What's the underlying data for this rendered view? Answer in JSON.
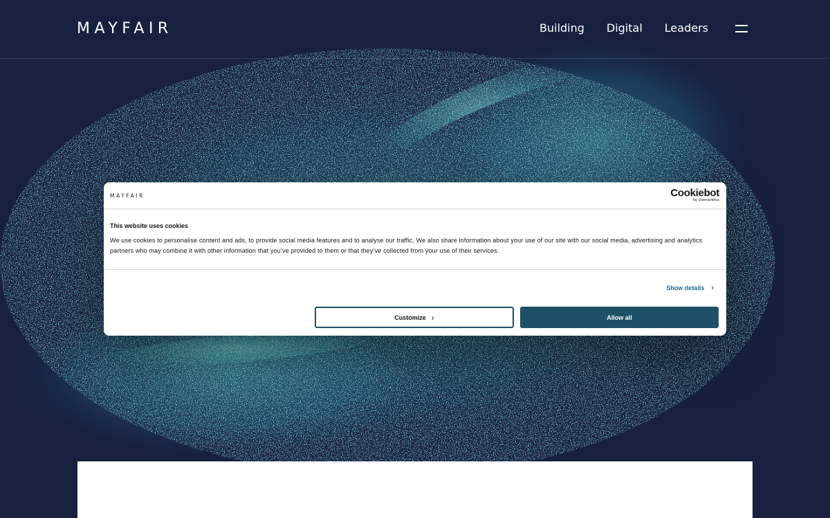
{
  "header": {
    "logo": "MAYFAIR",
    "nav": [
      "Building",
      "Digital",
      "Leaders"
    ],
    "menu_icon": "hamburger-menu-icon"
  },
  "cookie_banner": {
    "brand": "MAYFAIR",
    "provider": {
      "name": "Cookiebot",
      "sub": "by Usercentrics"
    },
    "title": "This website uses cookies",
    "text": "We use cookies to personalise content and ads, to provide social media features and to analyse our traffic. We also share information about your use of our site with our social media, advertising and analytics partners who may combine it with other information that you’ve provided to them or that they’ve collected from your use of their services.",
    "show_details": "Show details",
    "customize_label": "Customize",
    "allow_label": "Allow all",
    "accent_color": "#1d5168"
  },
  "colors": {
    "page_background": "#17213f",
    "particles": "#4fd9d4"
  }
}
